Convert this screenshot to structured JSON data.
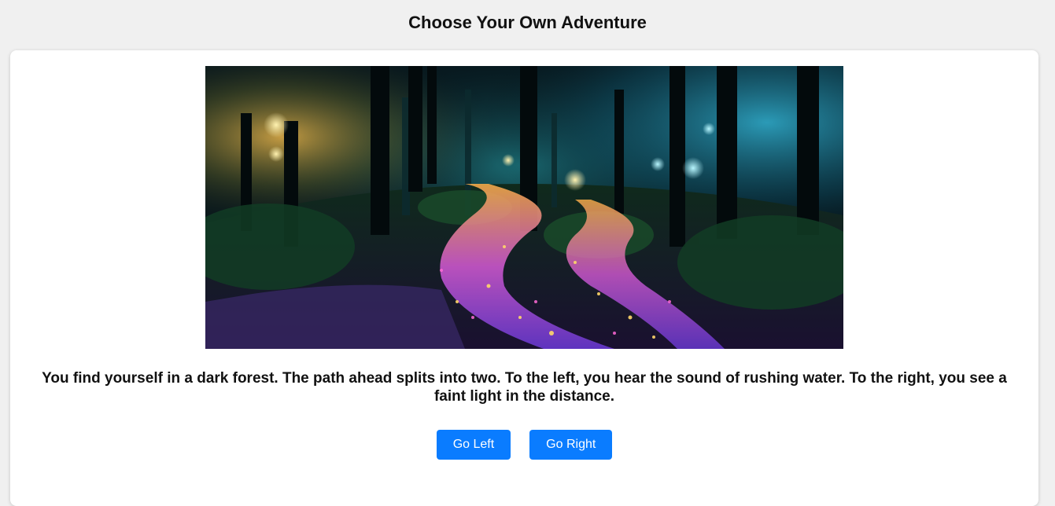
{
  "header": {
    "title": "Choose Your Own Adventure"
  },
  "scene": {
    "image_alt": "forest-path-split",
    "text": "You find yourself in a dark forest. The path ahead splits into two. To the left, you hear the sound of rushing water. To the right, you see a faint light in the distance."
  },
  "choices": [
    {
      "label": "Go Left"
    },
    {
      "label": "Go Right"
    }
  ],
  "colors": {
    "page_background": "#f0f0f0",
    "card_background": "#ffffff",
    "button_background": "#0a7cff",
    "button_text": "#ffffff"
  }
}
